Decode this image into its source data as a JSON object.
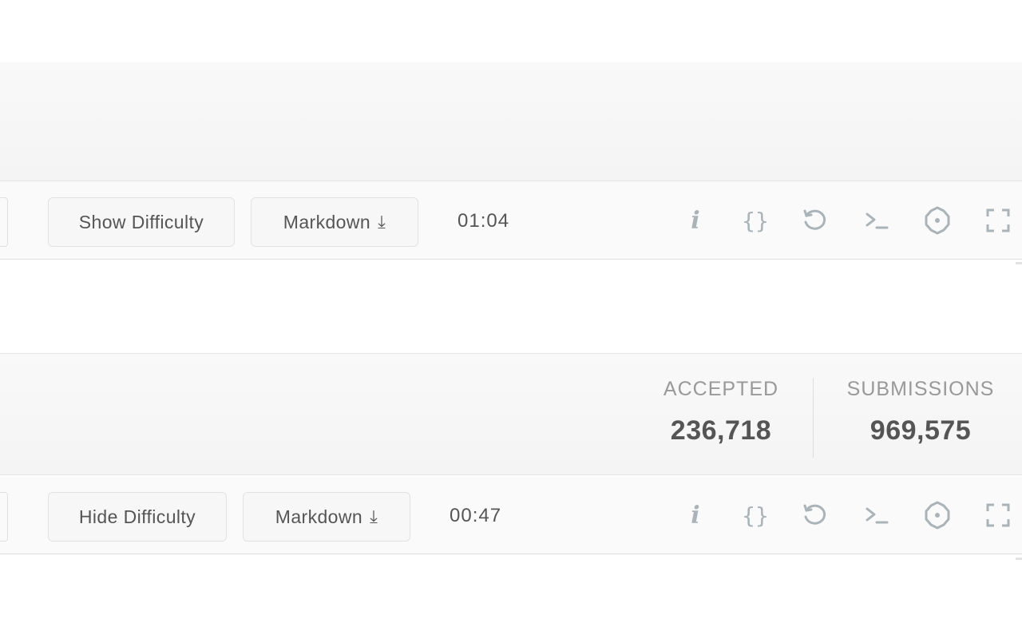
{
  "toolbars": [
    {
      "difficulty_button": "Show Difficulty",
      "markdown_button": "Markdown",
      "download_glyph": "⤓",
      "timer": "01:04"
    },
    {
      "difficulty_button": "Hide Difficulty",
      "markdown_button": "Markdown",
      "download_glyph": "⤓",
      "timer": "00:47"
    }
  ],
  "stats": {
    "accepted_label": "ACCEPTED",
    "accepted_value": "236,718",
    "submissions_label": "SUBMISSIONS",
    "submissions_value": "969,575"
  },
  "icons": {
    "info": "i",
    "braces": "{}",
    "reset": "reset-icon",
    "console": "console-icon",
    "settings": "settings-icon",
    "fullscreen": "fullscreen-icon"
  },
  "colors": {
    "icon": "#a9b4ba",
    "text": "#555555",
    "muted": "#999999",
    "border": "#e2e2e2",
    "band": "#f7f7f7"
  }
}
